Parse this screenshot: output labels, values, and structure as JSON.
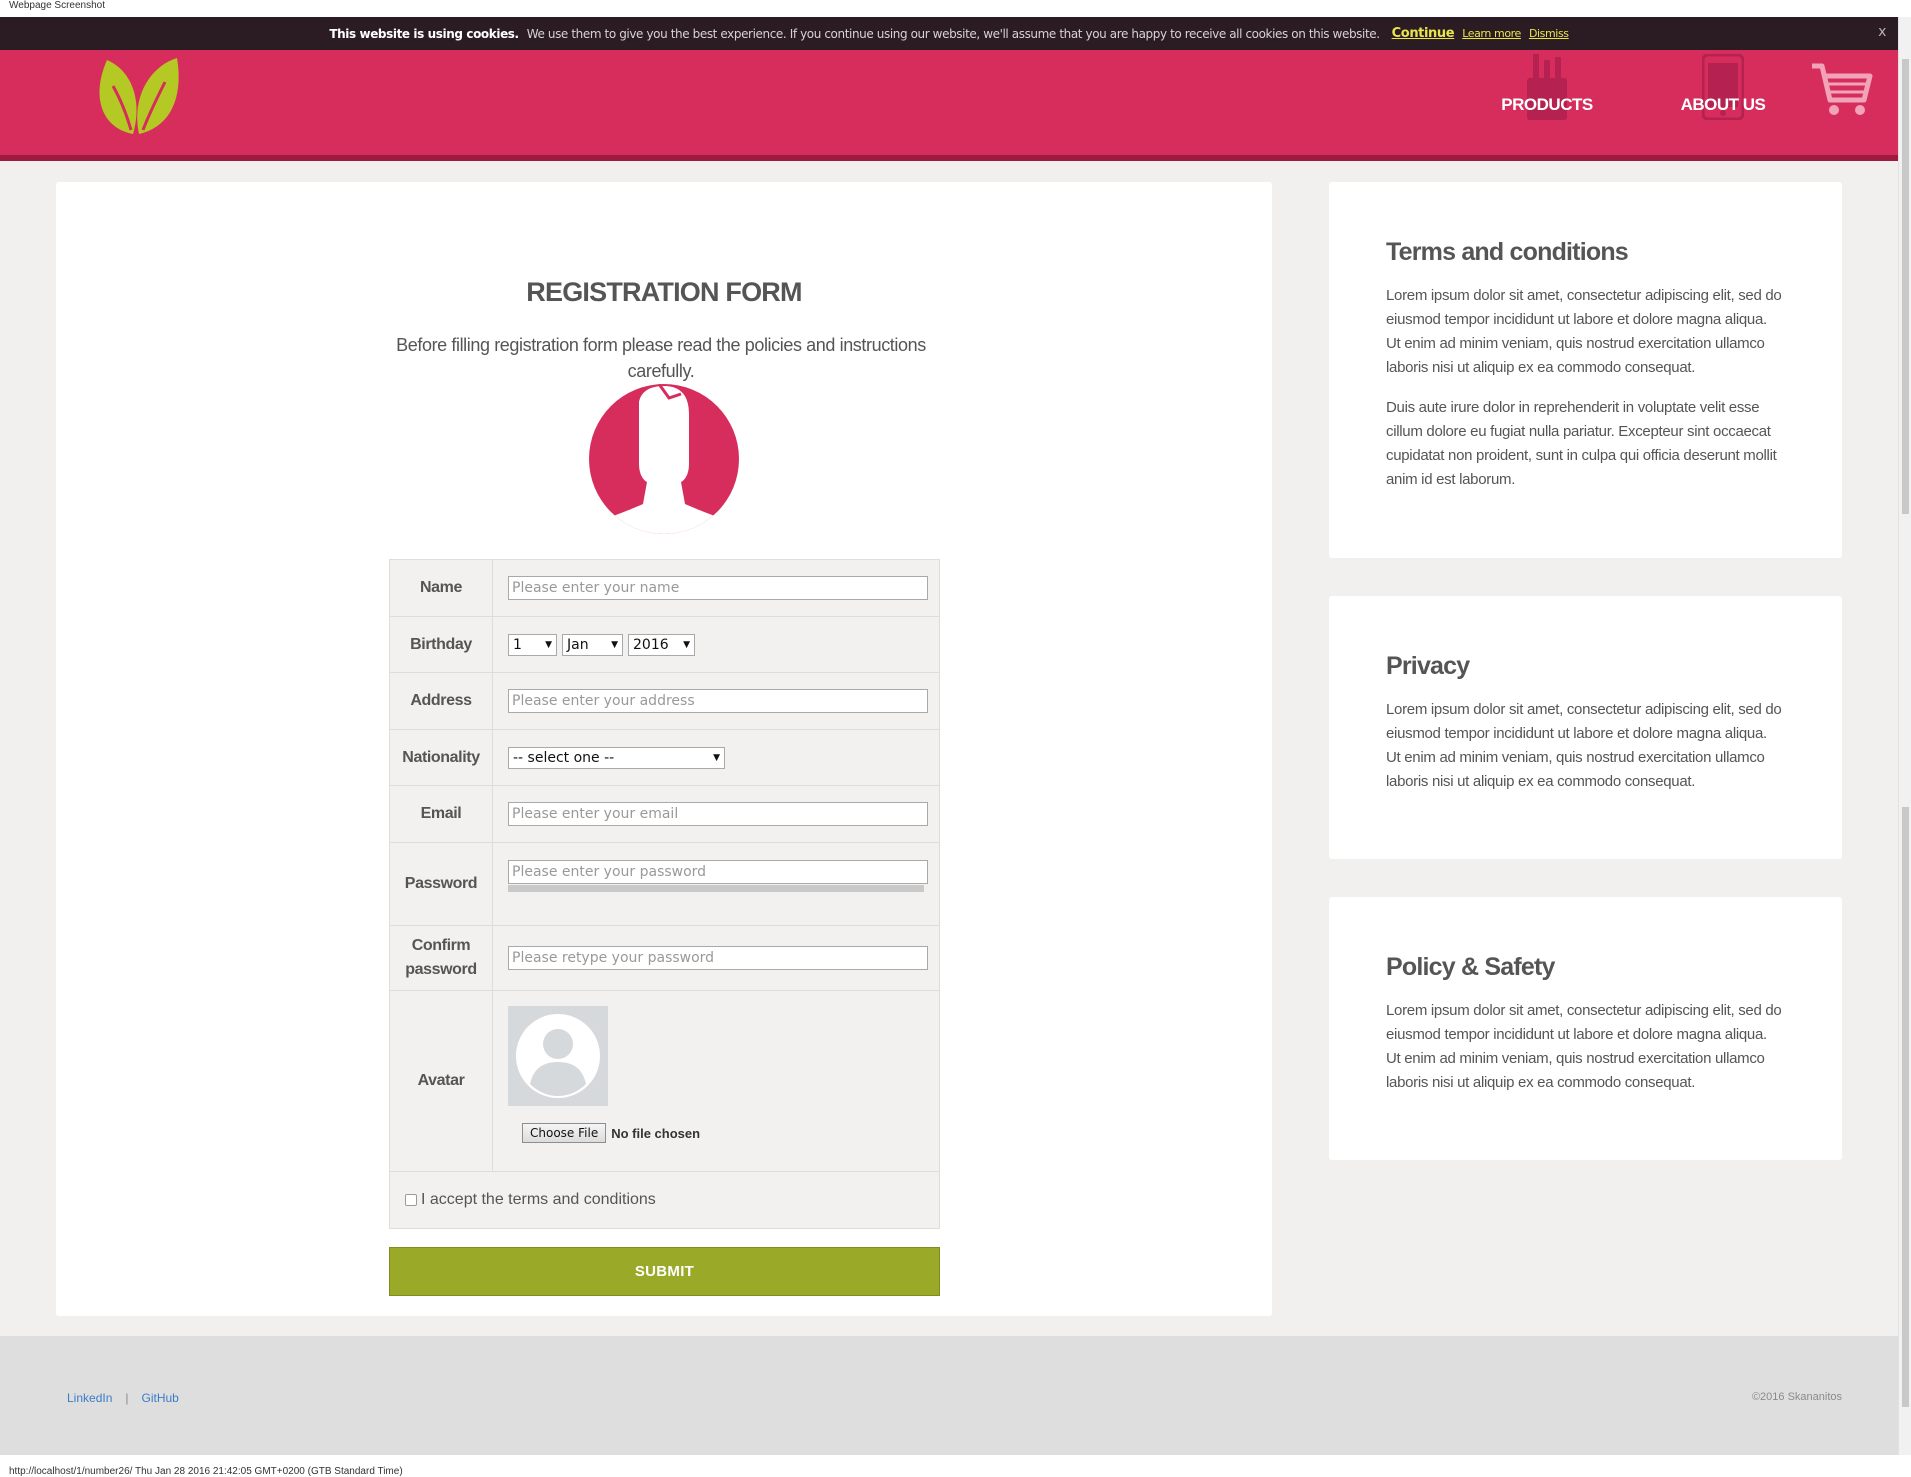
{
  "window": {
    "title": "Webpage Screenshot",
    "status_text": "http://localhost/1/number26/ Thu Jan 28 2016 21:42:05 GMT+0200 (GTB Standard Time)"
  },
  "colors": {
    "brand": "#d62d5c",
    "brand_dark": "#9e1b40",
    "accent": "#9aa927",
    "cookie_bg": "#2a1c22",
    "page_bg": "#f1f0ef",
    "cookie_link": "#e8e54b"
  },
  "cookie_bar": {
    "bold": "This website is using cookies.",
    "text": "We use them to give you the best experience. If you continue using our website, we'll assume that you are happy to receive all cookies on this website.",
    "continue_label": "Continue",
    "learn_more_label": "Learn more",
    "dismiss_label": "Dismiss",
    "close_label": "x"
  },
  "header": {
    "logo_icon": "leaf-logo-icon",
    "nav": [
      {
        "label": "PRODUCTS",
        "icon": "pencil-cup-icon"
      },
      {
        "label": "ABOUT US",
        "icon": "phone-icon"
      }
    ],
    "cart_icon": "cart-icon"
  },
  "form": {
    "title": "REGISTRATION FORM",
    "intro": "Before filling registration form please read the policies and instructions carefully.",
    "fields": {
      "name": {
        "label": "Name",
        "placeholder": "Please enter your name"
      },
      "birthday": {
        "label": "Birthday",
        "day": "1",
        "month": "Jan",
        "year": "2016"
      },
      "address": {
        "label": "Address",
        "placeholder": "Please enter your address"
      },
      "nationality": {
        "label": "Nationality",
        "value": "-- select one --"
      },
      "email": {
        "label": "Email",
        "placeholder": "Please enter your email"
      },
      "password": {
        "label": "Password",
        "placeholder": "Please enter your password"
      },
      "confirm": {
        "label_line1": "Confirm",
        "label_line2": "password",
        "placeholder": "Please retype your password"
      },
      "avatar": {
        "label": "Avatar",
        "button": "Choose File",
        "file_text": "No file chosen"
      }
    },
    "terms_label": "I accept the terms and conditions",
    "submit_label": "SUBMIT"
  },
  "sidebar": [
    {
      "title": "Terms and conditions",
      "paragraphs": [
        "Lorem ipsum dolor sit amet, consectetur adipiscing elit, sed do eiusmod tempor incididunt ut labore et dolore magna aliqua. Ut enim ad minim veniam, quis nostrud exercitation ullamco laboris nisi ut aliquip ex ea commodo consequat.",
        "Duis aute irure dolor in reprehenderit in voluptate velit esse cillum dolore eu fugiat nulla pariatur. Excepteur sint occaecat cupidatat non proident, sunt in culpa qui officia deserunt mollit anim id est laborum."
      ]
    },
    {
      "title": "Privacy",
      "paragraphs": [
        "Lorem ipsum dolor sit amet, consectetur adipiscing elit, sed do eiusmod tempor incididunt ut labore et dolore magna aliqua. Ut enim ad minim veniam, quis nostrud exercitation ullamco laboris nisi ut aliquip ex ea commodo consequat."
      ]
    },
    {
      "title": "Policy & Safety",
      "paragraphs": [
        "Lorem ipsum dolor sit amet, consectetur adipiscing elit, sed do eiusmod tempor incididunt ut labore et dolore magna aliqua. Ut enim ad minim veniam, quis nostrud exercitation ullamco laboris nisi ut aliquip ex ea commodo consequat."
      ]
    }
  ],
  "footer": {
    "links": [
      "LinkedIn",
      "GitHub"
    ],
    "separator": "|",
    "copyright": "©2016 Skananitos"
  }
}
